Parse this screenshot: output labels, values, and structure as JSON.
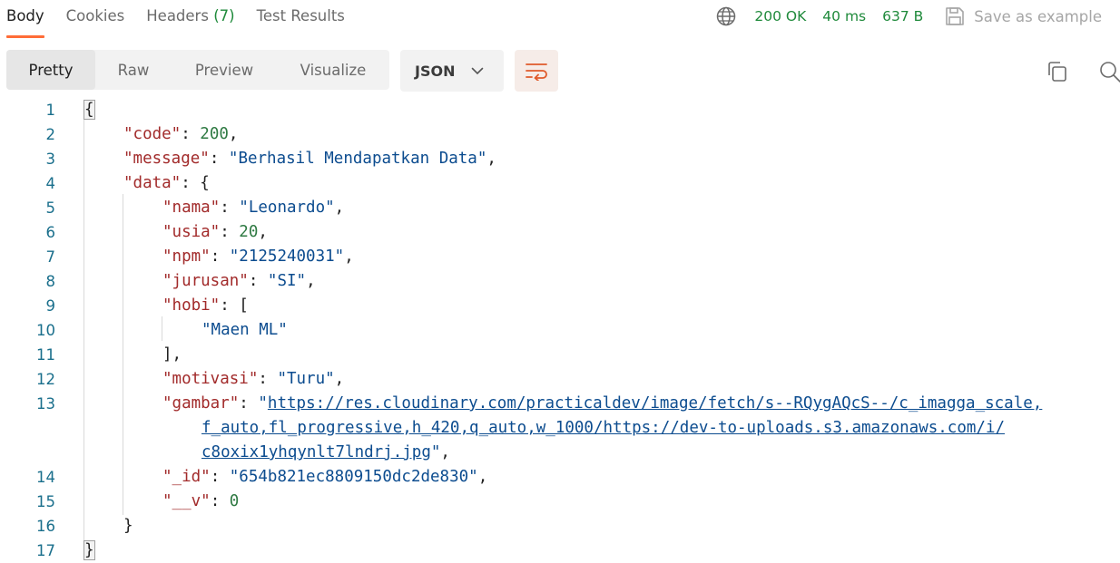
{
  "response_tabs": [
    {
      "label": "Body",
      "count": ""
    },
    {
      "label": "Cookies",
      "count": ""
    },
    {
      "label": "Headers",
      "count": "(7)"
    },
    {
      "label": "Test Results",
      "count": ""
    }
  ],
  "status": {
    "code": "200 OK",
    "time": "40 ms",
    "size": "637 B",
    "save_label": "Save as example"
  },
  "view_modes": [
    "Pretty",
    "Raw",
    "Preview",
    "Visualize"
  ],
  "format": "JSON",
  "icons": {
    "globe": "globe-icon",
    "save": "save-icon",
    "wrap": "wrap-lines-icon",
    "copy": "copy-icon",
    "search": "search-icon"
  },
  "colors": {
    "accent": "#ff6c37",
    "status_green": "#1f8a3b",
    "json_key": "#a22b2b",
    "json_string": "#0c4c8f",
    "json_number": "#2f7a43",
    "line_number": "#1a6f8c"
  },
  "code_lines": [
    {
      "no": "1",
      "indent": 0,
      "tokens": [
        {
          "t": "p",
          "v": "{"
        }
      ]
    },
    {
      "no": "2",
      "indent": 1,
      "tokens": [
        {
          "t": "k",
          "v": "\"code\""
        },
        {
          "t": "p",
          "v": ": "
        },
        {
          "t": "n",
          "v": "200"
        },
        {
          "t": "p",
          "v": ","
        }
      ]
    },
    {
      "no": "3",
      "indent": 1,
      "tokens": [
        {
          "t": "k",
          "v": "\"message\""
        },
        {
          "t": "p",
          "v": ": "
        },
        {
          "t": "s",
          "v": "\"Berhasil Mendapatkan Data\""
        },
        {
          "t": "p",
          "v": ","
        }
      ]
    },
    {
      "no": "4",
      "indent": 1,
      "tokens": [
        {
          "t": "k",
          "v": "\"data\""
        },
        {
          "t": "p",
          "v": ": {"
        }
      ]
    },
    {
      "no": "5",
      "indent": 2,
      "tokens": [
        {
          "t": "k",
          "v": "\"nama\""
        },
        {
          "t": "p",
          "v": ": "
        },
        {
          "t": "s",
          "v": "\"Leonardo\""
        },
        {
          "t": "p",
          "v": ","
        }
      ]
    },
    {
      "no": "6",
      "indent": 2,
      "tokens": [
        {
          "t": "k",
          "v": "\"usia\""
        },
        {
          "t": "p",
          "v": ": "
        },
        {
          "t": "n",
          "v": "20"
        },
        {
          "t": "p",
          "v": ","
        }
      ]
    },
    {
      "no": "7",
      "indent": 2,
      "tokens": [
        {
          "t": "k",
          "v": "\"npm\""
        },
        {
          "t": "p",
          "v": ": "
        },
        {
          "t": "s",
          "v": "\"2125240031\""
        },
        {
          "t": "p",
          "v": ","
        }
      ]
    },
    {
      "no": "8",
      "indent": 2,
      "tokens": [
        {
          "t": "k",
          "v": "\"jurusan\""
        },
        {
          "t": "p",
          "v": ": "
        },
        {
          "t": "s",
          "v": "\"SI\""
        },
        {
          "t": "p",
          "v": ","
        }
      ]
    },
    {
      "no": "9",
      "indent": 2,
      "tokens": [
        {
          "t": "k",
          "v": "\"hobi\""
        },
        {
          "t": "p",
          "v": ": ["
        }
      ]
    },
    {
      "no": "10",
      "indent": 3,
      "tokens": [
        {
          "t": "s",
          "v": "\"Maen ML\""
        }
      ]
    },
    {
      "no": "11",
      "indent": 2,
      "tokens": [
        {
          "t": "p",
          "v": "],"
        }
      ]
    },
    {
      "no": "12",
      "indent": 2,
      "tokens": [
        {
          "t": "k",
          "v": "\"motivasi\""
        },
        {
          "t": "p",
          "v": ": "
        },
        {
          "t": "s",
          "v": "\"Turu\""
        },
        {
          "t": "p",
          "v": ","
        }
      ]
    },
    {
      "no": "13",
      "indent": 2,
      "tokens": [
        {
          "t": "k",
          "v": "\"gambar\""
        },
        {
          "t": "p",
          "v": ": "
        },
        {
          "t": "s",
          "v": "\""
        },
        {
          "t": "u",
          "v": "https://res.cloudinary.com/practicaldev/image/fetch/s--RQygAQcS--/c_imagga_scale,"
        }
      ]
    },
    {
      "no": "",
      "indent": 3,
      "tokens": [
        {
          "t": "u",
          "v": "f_auto,fl_progressive,h_420,q_auto,w_1000/https://dev-to-uploads.s3.amazonaws.com/i/"
        }
      ]
    },
    {
      "no": "",
      "indent": 3,
      "tokens": [
        {
          "t": "u",
          "v": "c8oxix1yhqynlt7lndrj.jpg"
        },
        {
          "t": "s",
          "v": "\""
        },
        {
          "t": "p",
          "v": ","
        }
      ]
    },
    {
      "no": "14",
      "indent": 2,
      "tokens": [
        {
          "t": "k",
          "v": "\"_id\""
        },
        {
          "t": "p",
          "v": ": "
        },
        {
          "t": "s",
          "v": "\"654b821ec8809150dc2de830\""
        },
        {
          "t": "p",
          "v": ","
        }
      ]
    },
    {
      "no": "15",
      "indent": 2,
      "tokens": [
        {
          "t": "k",
          "v": "\"__v\""
        },
        {
          "t": "p",
          "v": ": "
        },
        {
          "t": "n",
          "v": "0"
        }
      ]
    },
    {
      "no": "16",
      "indent": 1,
      "tokens": [
        {
          "t": "p",
          "v": "}"
        }
      ]
    },
    {
      "no": "17",
      "indent": 0,
      "tokens": [
        {
          "t": "p",
          "v": "}"
        }
      ]
    }
  ]
}
